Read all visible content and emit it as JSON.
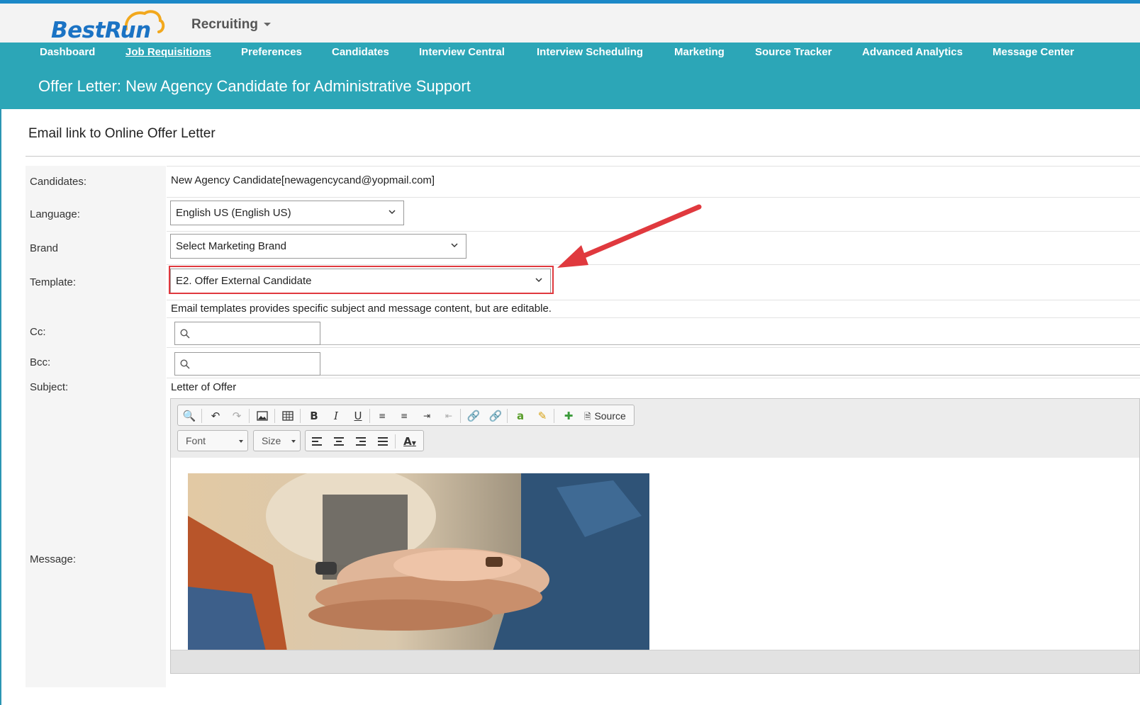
{
  "app": {
    "logo_text": "BestRun",
    "module": "Recruiting",
    "colors": {
      "teal": "#2ca6b7",
      "brand_blue": "#1b73c4",
      "highlight_red": "#e0393e"
    }
  },
  "nav": {
    "items": [
      {
        "label": "Dashboard"
      },
      {
        "label": "Job Requisitions"
      },
      {
        "label": "Preferences"
      },
      {
        "label": "Candidates"
      },
      {
        "label": "Interview Central"
      },
      {
        "label": "Interview Scheduling"
      },
      {
        "label": "Marketing"
      },
      {
        "label": "Source Tracker"
      },
      {
        "label": "Advanced Analytics"
      },
      {
        "label": "Message Center"
      }
    ],
    "active": "Job Requisitions"
  },
  "page": {
    "title": "Offer Letter: New Agency Candidate for Administrative Support",
    "section_title": "Email link to Online Offer Letter"
  },
  "form": {
    "candidates": {
      "label": "Candidates:",
      "value": "New Agency Candidate[newagencycand@yopmail.com]"
    },
    "language": {
      "label": "Language:",
      "value": "English US (English US)"
    },
    "brand": {
      "label": "Brand",
      "placeholder": "Select Marketing Brand"
    },
    "template": {
      "label": "Template:",
      "value": "E2. Offer External Candidate"
    },
    "template_hint": "Email templates provides specific subject and message content, but are editable.",
    "cc": {
      "label": "Cc:",
      "value": ""
    },
    "bcc": {
      "label": "Bcc:",
      "value": ""
    },
    "subject": {
      "label": "Subject:",
      "value": "Letter of Offer"
    },
    "message": {
      "label": "Message:"
    }
  },
  "editor": {
    "toolbar_row1": [
      "preview-icon",
      "undo-icon",
      "redo-icon",
      "image-icon",
      "table-icon",
      "bold-icon",
      "italic-icon",
      "underline-icon",
      "numbered-list-icon",
      "bulleted-list-icon",
      "indent-icon",
      "outdent-icon",
      "link-icon",
      "unlink-icon",
      "spellcheck-icon",
      "highlight-icon",
      "insert-field-icon"
    ],
    "source_label": "Source",
    "font_label": "Font",
    "size_label": "Size",
    "toolbar_row2": [
      "align-left-icon",
      "align-center-icon",
      "align-right-icon",
      "justify-icon",
      "text-color-icon"
    ],
    "content_image": "stacked-hands-photo"
  }
}
